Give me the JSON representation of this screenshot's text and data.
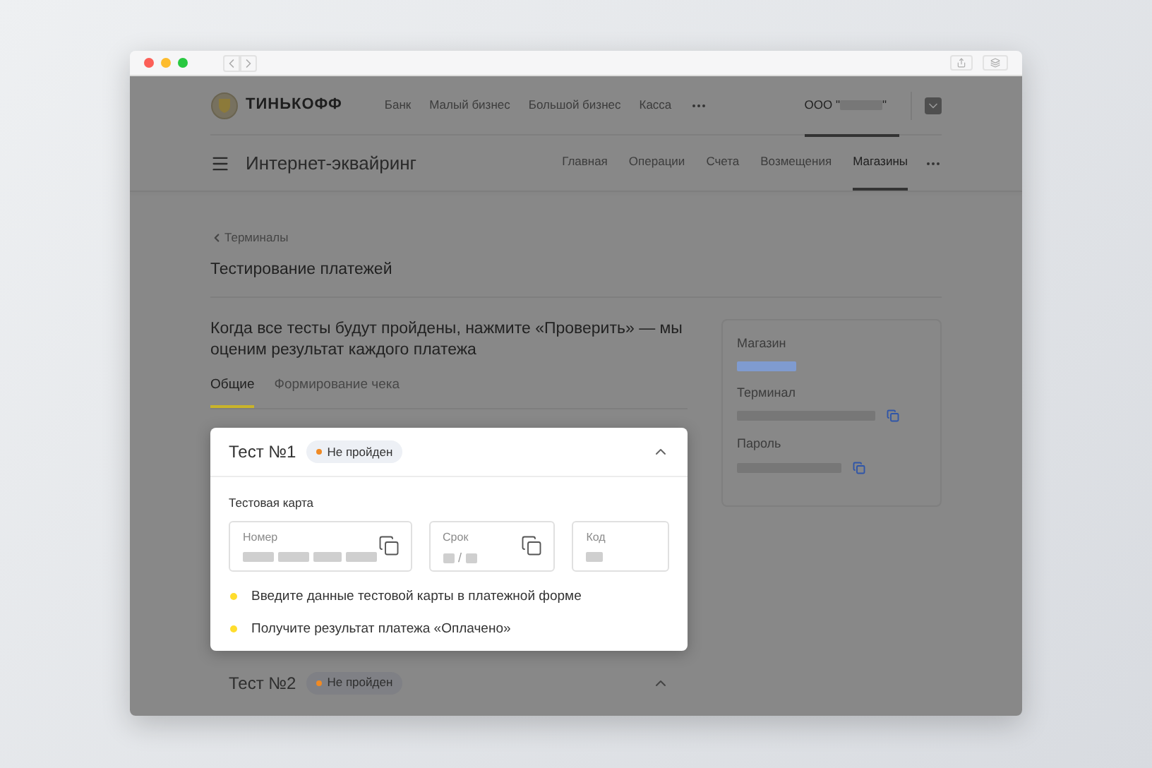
{
  "brand": {
    "name": "ТИНЬКОФФ"
  },
  "top_nav": [
    {
      "label": "Банк"
    },
    {
      "label": "Малый бизнес"
    },
    {
      "label": "Большой бизнес"
    },
    {
      "label": "Касса"
    }
  ],
  "company": {
    "prefix": "ООО \"",
    "suffix": "\""
  },
  "product": {
    "title": "Интернет-эквайринг"
  },
  "sub_nav": [
    {
      "label": "Главная",
      "selected": false
    },
    {
      "label": "Операции",
      "selected": false
    },
    {
      "label": "Счета",
      "selected": false
    },
    {
      "label": "Возмещения",
      "selected": false
    },
    {
      "label": "Магазины",
      "selected": true
    }
  ],
  "breadcrumb": "Терминалы",
  "page_title": "Тестирование платежей",
  "description": "Когда все тесты будут пройдены, нажмите «Проверить» — мы оценим результат каждого платежа",
  "tabs": [
    {
      "label": "Общие",
      "selected": true
    },
    {
      "label": "Формирование чека",
      "selected": false
    }
  ],
  "tests": [
    {
      "title": "Тест №1",
      "status": "Не пройден",
      "color": "#f08a24",
      "highlighted": true,
      "card_label": "Тестовая карта",
      "fields": [
        {
          "kind": "number",
          "label": "Номер",
          "copy": true
        },
        {
          "kind": "expiry",
          "label": "Срок",
          "separator": "/",
          "copy": true
        },
        {
          "kind": "code",
          "label": "Код",
          "copy": false
        }
      ],
      "steps": [
        {
          "text": "Введите данные тестовой карты в платежной форме",
          "color": "#ffdd2d"
        },
        {
          "text": "Получите результат платежа «Оплачено»",
          "color": "#ffdd2d"
        }
      ]
    },
    {
      "title": "Тест №2",
      "status": "Не пройден",
      "color": "#f08a24",
      "highlighted": false
    }
  ],
  "side_card": {
    "items": [
      {
        "label": "Магазин",
        "kind": "link",
        "copy": false
      },
      {
        "label": "Терминал",
        "kind": "text",
        "copy": true
      },
      {
        "label": "Пароль",
        "kind": "text",
        "copy": true
      }
    ]
  }
}
